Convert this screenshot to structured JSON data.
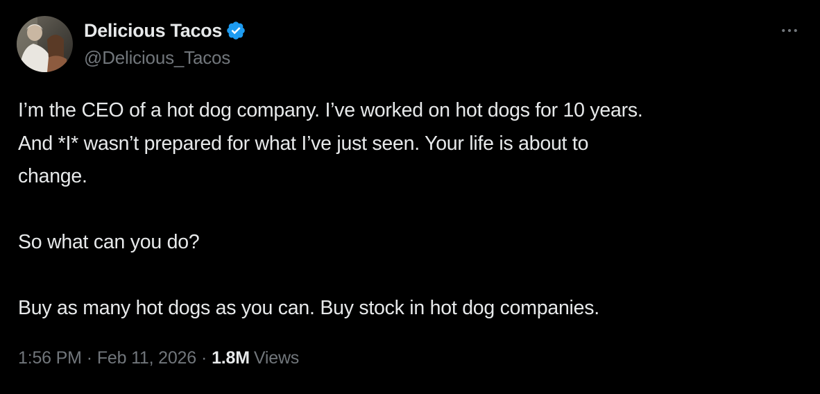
{
  "author": {
    "display_name": "Delicious Tacos",
    "handle": "@Delicious_Tacos",
    "verified": true,
    "verified_color": "#1d9bf0",
    "avatar_icon": "profile-photo"
  },
  "menu": {
    "icon": "more-horizontal-icon"
  },
  "tweet": {
    "paragraphs": [
      "I’m the CEO of a hot dog company. I’ve worked on hot dogs for 10 years.\nAnd *I* wasn’t prepared for what I’ve just seen. Your life is about to\nchange.",
      "So what can you do?",
      "Buy as many hot dogs as you can. Buy stock in hot dog companies."
    ]
  },
  "meta": {
    "time": "1:56 PM",
    "separator": "·",
    "date": "Feb 11, 2026",
    "views_count": "1.8M",
    "views_label": "Views"
  },
  "colors": {
    "background": "#000000",
    "primary_text": "#e7e9ea",
    "secondary_text": "#71767b"
  }
}
